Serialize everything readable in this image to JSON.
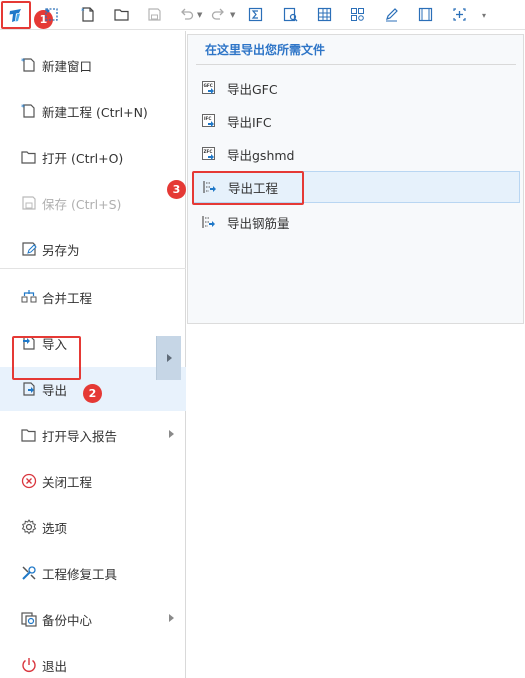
{
  "toolbar": {
    "items": [
      "app-menu",
      "select",
      "new",
      "open",
      "save",
      "undo",
      "redo",
      "formula",
      "report-view",
      "grid-query",
      "zoom-fit",
      "edit",
      "film",
      "custom-tool",
      "more"
    ]
  },
  "callouts": {
    "one": "1",
    "two": "2",
    "three": "3"
  },
  "menu": {
    "items": [
      {
        "label": "新建窗口"
      },
      {
        "label": "新建工程 (Ctrl+N)"
      },
      {
        "label": "打开 (Ctrl+O)"
      },
      {
        "label": "保存 (Ctrl+S)"
      },
      {
        "label": "另存为"
      },
      {
        "label": "合并工程"
      },
      {
        "label": "导入"
      },
      {
        "label": "导出"
      },
      {
        "label": "打开导入报告"
      },
      {
        "label": "关闭工程"
      },
      {
        "label": "选项"
      },
      {
        "label": "工程修复工具"
      },
      {
        "label": "备份中心"
      },
      {
        "label": "退出"
      }
    ]
  },
  "export_panel": {
    "title": "在这里导出您所需文件",
    "items": [
      {
        "label": "导出GFC",
        "badge": "GFC"
      },
      {
        "label": "导出IFC",
        "badge": "IFC"
      },
      {
        "label": "导出gshmd",
        "badge": "ZFC"
      },
      {
        "label": "导出工程"
      },
      {
        "label": "导出钢筋量"
      }
    ]
  },
  "colors": {
    "accent": "#2e75c7",
    "callout": "#e53935",
    "active_bg": "#e8f2fc"
  }
}
